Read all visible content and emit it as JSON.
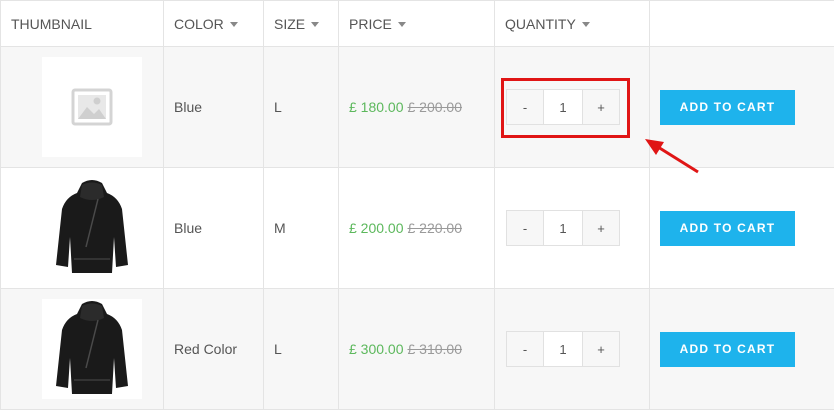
{
  "columns": {
    "thumbnail": "THUMBNAIL",
    "color": "COLOR",
    "size": "SIZE",
    "price": "PRICE",
    "quantity": "QUANTITY"
  },
  "rows": [
    {
      "thumbnail_icon": "image-placeholder-icon",
      "color": "Blue",
      "size": "L",
      "price": "£ 180.00",
      "old_price": "£ 200.00",
      "qty_minus": "-",
      "qty_value": "1",
      "qty_plus": "+",
      "cart_label": "ADD TO CART"
    },
    {
      "thumbnail_icon": "black-hoodie",
      "color": "Blue",
      "size": "M",
      "price": "£ 200.00",
      "old_price": "£ 220.00",
      "qty_minus": "-",
      "qty_value": "1",
      "qty_plus": "+",
      "cart_label": "ADD TO CART"
    },
    {
      "thumbnail_icon": "black-hoodie",
      "color": "Red Color",
      "size": "L",
      "price": "£ 300.00",
      "old_price": "£ 310.00",
      "qty_minus": "-",
      "qty_value": "1",
      "qty_plus": "+",
      "cart_label": "ADD TO CART"
    }
  ],
  "colors": {
    "price_green": "#5cb85c",
    "cart_blue": "#1eb3ec",
    "annotation_red": "#e01515"
  }
}
